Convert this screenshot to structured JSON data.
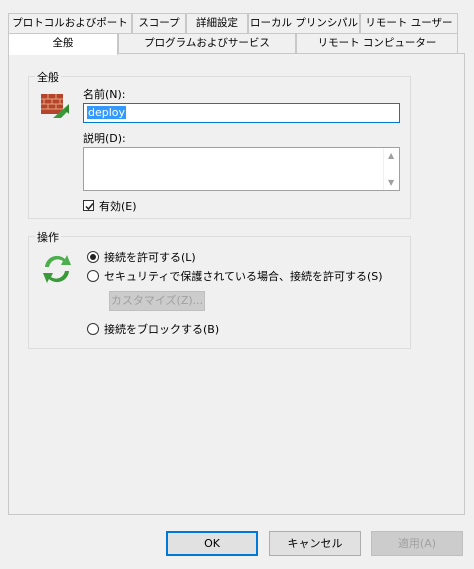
{
  "tabs_row1": [
    {
      "label": "プロトコルおよびポート"
    },
    {
      "label": "スコープ"
    },
    {
      "label": "詳細設定"
    },
    {
      "label": "ローカル プリンシパル"
    },
    {
      "label": "リモート ユーザー"
    }
  ],
  "tabs_row2": [
    {
      "label": "全般",
      "active": true
    },
    {
      "label": "プログラムおよびサービス"
    },
    {
      "label": "リモート コンピューター"
    }
  ],
  "general_group": {
    "title": "全般",
    "name_label": "名前(N):",
    "name_value": "deploy",
    "description_label": "説明(D):",
    "description_value": "",
    "enabled_label": "有効(E)",
    "enabled": true
  },
  "action_group": {
    "title": "操作",
    "options": [
      {
        "label": "接続を許可する(L)",
        "selected": true
      },
      {
        "label": "セキュリティで保護されている場合、接続を許可する(S)",
        "selected": false
      },
      {
        "label": "接続をブロックする(B)",
        "selected": false
      }
    ],
    "customize_label": "カスタマイズ(Z)..."
  },
  "footer": {
    "ok_label": "OK",
    "cancel_label": "キャンセル",
    "apply_label": "適用(A)"
  }
}
